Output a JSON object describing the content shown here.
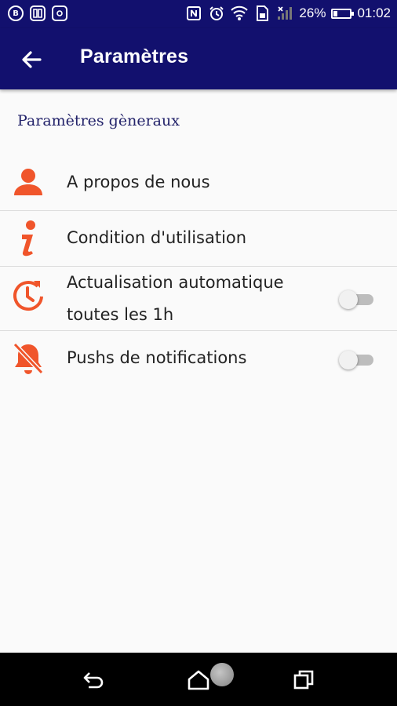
{
  "statusbar": {
    "left_icons": [
      {
        "name": "b-notification-icon",
        "glyph": "B"
      },
      {
        "name": "book-notification-icon",
        "glyph": ""
      },
      {
        "name": "instagram-notification-icon",
        "glyph": ""
      }
    ],
    "battery_percent": "26%",
    "battery_level": 0.26,
    "time": "01:02"
  },
  "appbar": {
    "title": "Paramètres",
    "background": "#12106e"
  },
  "section": {
    "title": "Paramètres gèneraux"
  },
  "settings": [
    {
      "id": "about",
      "icon": "person-icon",
      "label": "A propos de nous",
      "has_toggle": false
    },
    {
      "id": "terms",
      "icon": "info-icon",
      "label": "Condition d'utilisation",
      "has_toggle": false
    },
    {
      "id": "auto-refresh",
      "icon": "history-clock-icon",
      "label_line1": "Actualisation automatique",
      "label_line2": "toutes les 1h",
      "has_toggle": true,
      "enabled": false
    },
    {
      "id": "push",
      "icon": "bell-off-icon",
      "label": "Pushs de notifications",
      "has_toggle": true,
      "enabled": false
    }
  ],
  "colors": {
    "accent": "#f0552b",
    "section_title": "#23236a",
    "toggle_track": "#bdbdbd"
  },
  "navbar": {
    "buttons": [
      "back-nav-icon",
      "home-nav-icon",
      "recents-nav-icon"
    ]
  }
}
